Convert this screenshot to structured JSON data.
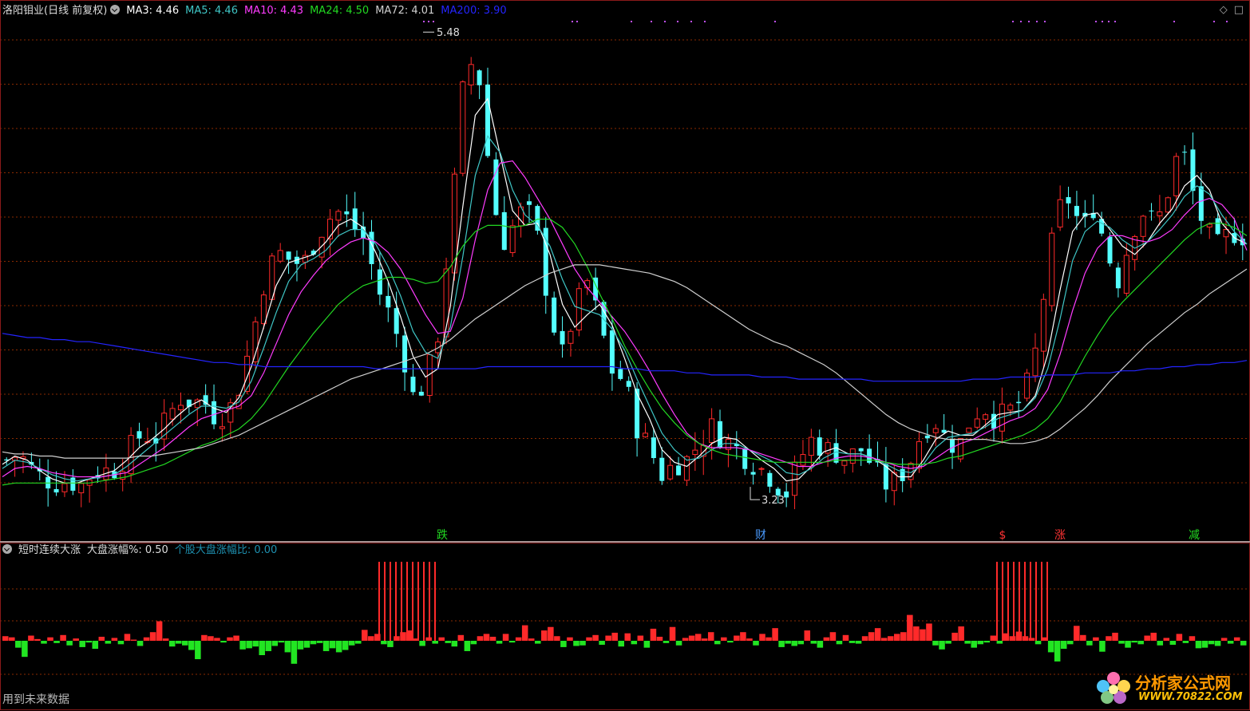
{
  "header": {
    "title": "洛阳钼业(日线 前复权)",
    "ma": [
      {
        "label": "MA3: 4.46",
        "color": "#ffffff"
      },
      {
        "label": "MA5: 4.46",
        "color": "#3fc6c6"
      },
      {
        "label": "MA10: 4.43",
        "color": "#ff3cff"
      },
      {
        "label": "MA24: 4.50",
        "color": "#22d822"
      },
      {
        "label": "MA72: 4.01",
        "color": "#d0d0d0"
      },
      {
        "label": "MA200: 3.90",
        "color": "#2424ff"
      }
    ]
  },
  "sub_header": {
    "name": "短时连续大涨",
    "index_change": "大盘涨幅%: 0.50",
    "ratio": "个股大盘涨幅比: 0.00",
    "ratio_color": "#1e90b0"
  },
  "footer_note": "用到未来数据",
  "watermark": {
    "text": "分析家公式网",
    "url": "WWW.70822.COM"
  },
  "corner_icons": [
    "diamond-icon",
    "square-icon"
  ],
  "colors": {
    "up": "#ff2a2a",
    "down": "#54ffff",
    "grid": "#8a2a00"
  },
  "chart_data": [
    {
      "type": "candlestick",
      "ylim": [
        3.1,
        5.55
      ],
      "annotations": [
        {
          "label": "5.48",
          "price": 5.48,
          "kind": "high"
        },
        {
          "label": "3.23",
          "price": 3.23,
          "kind": "low"
        }
      ],
      "event_markers": [
        {
          "label": "跌",
          "color": "#22d822"
        },
        {
          "label": "财",
          "color": "#4a9bff"
        },
        {
          "label": "$",
          "color": "#ff3333"
        },
        {
          "label": "涨",
          "color": "#ff3333"
        },
        {
          "label": "减",
          "color": "#22d822"
        }
      ],
      "close_path": [
        3.42,
        3.45,
        3.38,
        3.33,
        3.31,
        3.32,
        3.3,
        3.36,
        3.37,
        3.38,
        3.48,
        3.55,
        3.52,
        3.62,
        3.72,
        3.7,
        3.7,
        3.62,
        3.66,
        3.8,
        4.05,
        4.32,
        4.42,
        4.38,
        4.36,
        4.48,
        4.58,
        4.62,
        4.55,
        4.48,
        4.25,
        4.12,
        3.95,
        3.7,
        3.82,
        4.05,
        4.6,
        5.25,
        5.38,
        4.85,
        4.45,
        4.55,
        4.65,
        4.48,
        4.12,
        3.92,
        4.15,
        4.28,
        4.08,
        3.85,
        3.8,
        3.58,
        3.48,
        3.35,
        3.4,
        3.42,
        3.5,
        3.58,
        3.52,
        3.48,
        3.42,
        3.38,
        3.33,
        3.25,
        3.4,
        3.52,
        3.48,
        3.46,
        3.42,
        3.48,
        3.4,
        3.3,
        3.32,
        3.4,
        3.55,
        3.62,
        3.52,
        3.48,
        3.62,
        3.68,
        3.62,
        3.65,
        3.7,
        3.85,
        4.25,
        4.62,
        4.68,
        4.52,
        4.65,
        4.42,
        4.28,
        4.52,
        4.62,
        4.55,
        4.72,
        4.95,
        4.7,
        4.52,
        4.45,
        4.52,
        4.5
      ],
      "ma3": [
        3.4,
        3.44,
        3.42,
        3.37,
        3.33,
        3.31,
        3.31,
        3.33,
        3.35,
        3.37,
        3.42,
        3.48,
        3.52,
        3.57,
        3.63,
        3.68,
        3.71,
        3.67,
        3.65,
        3.72,
        3.87,
        4.06,
        4.26,
        4.37,
        4.39,
        4.41,
        4.47,
        4.55,
        4.58,
        4.54,
        4.42,
        4.28,
        4.11,
        3.92,
        3.82,
        3.86,
        4.16,
        4.64,
        5.08,
        5.16,
        4.89,
        4.62,
        4.55,
        4.56,
        4.41,
        4.17,
        4.06,
        4.12,
        4.17,
        4.07,
        3.91,
        3.74,
        3.62,
        3.47,
        3.41,
        3.39,
        3.44,
        3.5,
        3.53,
        3.52,
        3.47,
        3.42,
        3.38,
        3.32,
        3.33,
        3.39,
        3.46,
        3.48,
        3.45,
        3.45,
        3.43,
        3.39,
        3.34,
        3.34,
        3.42,
        3.52,
        3.56,
        3.54,
        3.54,
        3.59,
        3.64,
        3.65,
        3.66,
        3.73,
        3.93,
        4.24,
        4.52,
        4.6,
        4.61,
        4.53,
        4.45,
        4.41,
        4.47,
        4.56,
        4.63,
        4.74,
        4.79,
        4.72,
        4.56,
        4.49,
        4.46
      ],
      "ma5": [
        3.38,
        3.42,
        3.41,
        3.38,
        3.35,
        3.33,
        3.32,
        3.33,
        3.34,
        3.35,
        3.39,
        3.44,
        3.49,
        3.54,
        3.59,
        3.64,
        3.68,
        3.68,
        3.67,
        3.7,
        3.8,
        3.96,
        4.13,
        4.28,
        4.36,
        4.39,
        4.43,
        4.5,
        4.53,
        4.53,
        4.46,
        4.35,
        4.21,
        4.04,
        3.94,
        3.91,
        4.06,
        4.4,
        4.79,
        4.98,
        4.9,
        4.72,
        4.6,
        4.55,
        4.45,
        4.29,
        4.16,
        4.14,
        4.12,
        4.05,
        3.95,
        3.81,
        3.68,
        3.55,
        3.47,
        3.42,
        3.43,
        3.47,
        3.5,
        3.5,
        3.47,
        3.44,
        3.41,
        3.36,
        3.35,
        3.38,
        3.43,
        3.46,
        3.45,
        3.45,
        3.43,
        3.4,
        3.37,
        3.36,
        3.4,
        3.48,
        3.53,
        3.54,
        3.55,
        3.58,
        3.62,
        3.64,
        3.66,
        3.72,
        3.86,
        4.1,
        4.38,
        4.52,
        4.57,
        4.54,
        4.48,
        4.44,
        4.47,
        4.53,
        4.6,
        4.69,
        4.74,
        4.7,
        4.6,
        4.52,
        4.46
      ],
      "ma10": [
        3.34,
        3.38,
        3.39,
        3.38,
        3.36,
        3.35,
        3.34,
        3.34,
        3.34,
        3.35,
        3.36,
        3.4,
        3.44,
        3.48,
        3.53,
        3.58,
        3.62,
        3.64,
        3.66,
        3.68,
        3.73,
        3.84,
        3.98,
        4.12,
        4.23,
        4.31,
        4.38,
        4.43,
        4.47,
        4.49,
        4.47,
        4.42,
        4.34,
        4.23,
        4.12,
        4.03,
        4.04,
        4.2,
        4.48,
        4.72,
        4.85,
        4.86,
        4.78,
        4.68,
        4.58,
        4.46,
        4.34,
        4.25,
        4.18,
        4.11,
        4.04,
        3.95,
        3.85,
        3.74,
        3.64,
        3.55,
        3.5,
        3.48,
        3.48,
        3.48,
        3.47,
        3.45,
        3.43,
        3.41,
        3.39,
        3.39,
        3.41,
        3.43,
        3.44,
        3.44,
        3.43,
        3.41,
        3.39,
        3.38,
        3.39,
        3.43,
        3.47,
        3.5,
        3.52,
        3.55,
        3.58,
        3.61,
        3.63,
        3.67,
        3.76,
        3.93,
        4.14,
        4.32,
        4.44,
        4.5,
        4.5,
        4.48,
        4.47,
        4.49,
        4.53,
        4.6,
        4.66,
        4.68,
        4.65,
        4.58,
        4.43
      ],
      "ma24": [
        3.3,
        3.31,
        3.31,
        3.31,
        3.31,
        3.31,
        3.31,
        3.31,
        3.32,
        3.33,
        3.34,
        3.36,
        3.38,
        3.4,
        3.43,
        3.46,
        3.49,
        3.51,
        3.54,
        3.57,
        3.62,
        3.69,
        3.78,
        3.87,
        3.95,
        4.03,
        4.1,
        4.17,
        4.22,
        4.26,
        4.28,
        4.3,
        4.3,
        4.29,
        4.27,
        4.28,
        4.35,
        4.45,
        4.52,
        4.55,
        4.55,
        4.54,
        4.55,
        4.58,
        4.58,
        4.54,
        4.46,
        4.35,
        4.22,
        4.1,
        3.97,
        3.86,
        3.76,
        3.67,
        3.6,
        3.54,
        3.5,
        3.47,
        3.45,
        3.44,
        3.43,
        3.42,
        3.41,
        3.41,
        3.41,
        3.41,
        3.41,
        3.42,
        3.42,
        3.42,
        3.42,
        3.41,
        3.4,
        3.4,
        3.4,
        3.41,
        3.43,
        3.44,
        3.46,
        3.48,
        3.5,
        3.52,
        3.54,
        3.57,
        3.62,
        3.7,
        3.81,
        3.92,
        4.02,
        4.11,
        4.18,
        4.24,
        4.3,
        4.36,
        4.42,
        4.48,
        4.53,
        4.56,
        4.56,
        4.54,
        4.5
      ],
      "ma72": [
        3.46,
        3.45,
        3.45,
        3.44,
        3.44,
        3.43,
        3.43,
        3.43,
        3.43,
        3.43,
        3.43,
        3.44,
        3.44,
        3.45,
        3.46,
        3.47,
        3.48,
        3.5,
        3.52,
        3.54,
        3.57,
        3.6,
        3.63,
        3.66,
        3.69,
        3.72,
        3.75,
        3.78,
        3.81,
        3.83,
        3.85,
        3.87,
        3.89,
        3.91,
        3.93,
        3.96,
        4.0,
        4.05,
        4.1,
        4.14,
        4.18,
        4.22,
        4.26,
        4.29,
        4.32,
        4.34,
        4.36,
        4.36,
        4.36,
        4.35,
        4.34,
        4.33,
        4.32,
        4.3,
        4.28,
        4.25,
        4.21,
        4.17,
        4.13,
        4.09,
        4.05,
        4.02,
        3.99,
        3.97,
        3.94,
        3.91,
        3.88,
        3.84,
        3.79,
        3.74,
        3.69,
        3.64,
        3.6,
        3.57,
        3.55,
        3.53,
        3.52,
        3.52,
        3.52,
        3.52,
        3.51,
        3.5,
        3.5,
        3.51,
        3.53,
        3.57,
        3.62,
        3.67,
        3.73,
        3.8,
        3.86,
        3.92,
        3.98,
        4.03,
        4.08,
        4.13,
        4.17,
        4.22,
        4.26,
        4.3,
        4.34
      ],
      "ma200": [
        4.03,
        4.02,
        4.01,
        4.01,
        4.0,
        4.0,
        3.99,
        3.99,
        3.98,
        3.97,
        3.96,
        3.95,
        3.94,
        3.93,
        3.92,
        3.91,
        3.9,
        3.89,
        3.89,
        3.88,
        3.88,
        3.87,
        3.87,
        3.87,
        3.87,
        3.87,
        3.87,
        3.87,
        3.87,
        3.87,
        3.86,
        3.86,
        3.86,
        3.86,
        3.86,
        3.86,
        3.86,
        3.86,
        3.86,
        3.87,
        3.87,
        3.87,
        3.87,
        3.87,
        3.87,
        3.87,
        3.87,
        3.87,
        3.87,
        3.87,
        3.86,
        3.86,
        3.85,
        3.85,
        3.85,
        3.84,
        3.84,
        3.83,
        3.83,
        3.83,
        3.83,
        3.82,
        3.82,
        3.82,
        3.81,
        3.81,
        3.81,
        3.81,
        3.81,
        3.81,
        3.8,
        3.8,
        3.8,
        3.8,
        3.8,
        3.8,
        3.8,
        3.8,
        3.81,
        3.81,
        3.81,
        3.82,
        3.82,
        3.82,
        3.83,
        3.83,
        3.83,
        3.84,
        3.84,
        3.84,
        3.85,
        3.85,
        3.86,
        3.86,
        3.87,
        3.87,
        3.88,
        3.88,
        3.89,
        3.89,
        3.9
      ]
    },
    {
      "type": "bar",
      "baseline": 0,
      "spike_groups": [
        {
          "label": "group-1",
          "count": 11
        },
        {
          "label": "group-2",
          "count": 10
        }
      ],
      "values": [
        0.8,
        0.6,
        -1.2,
        -2.8,
        0.9,
        0.3,
        -0.5,
        0.6,
        -0.4,
        1.0,
        -0.8,
        0.4,
        -1.1,
        -0.3,
        -1.4,
        0.7,
        -0.5,
        0.5,
        -0.6,
        1.2,
        0.2,
        -0.9,
        0.6,
        1.5,
        3.4,
        0.4,
        -1.0,
        -0.5,
        -0.8,
        -1.6,
        -3.2,
        1.0,
        0.8,
        0.5,
        -0.3,
        0.6,
        0.9,
        -1.5,
        -1.3,
        -1.0,
        -2.5,
        -1.8,
        -0.9,
        -0.3,
        -2.0,
        -4.0,
        -1.5,
        -1.2,
        -0.6,
        -0.4,
        -1.8,
        -1.3,
        -2.0,
        -1.6,
        -0.8,
        -0.5,
        1.9,
        0.8,
        1.2,
        -0.6,
        -1.1,
        0.8,
        1.5,
        1.8,
        0.4,
        -0.9,
        0.6,
        -0.5,
        0.6,
        -0.4,
        -1.0,
        1.0,
        -1.8,
        -0.6,
        0.8,
        1.2,
        0.7,
        -0.5,
        1.2,
        -0.3,
        0.6,
        2.7,
        0.4,
        -0.5,
        1.8,
        2.4,
        0.8,
        -1.1,
        0.6,
        -0.9,
        -0.8,
        0.6,
        1.0,
        -0.7,
        0.9,
        1.4,
        -1.0,
        1.3,
        -0.6,
        0.9,
        -1.2,
        2.1,
        0.7,
        -0.4,
        2.4,
        -0.8,
        0.5,
        0.9,
        1.2,
        0.4,
        1.5,
        -0.6,
        0.6,
        -0.3,
        0.9,
        1.5,
        0.4,
        -0.8,
        1.2,
        0.6,
        2.2,
        -1.1,
        -0.5,
        -0.9,
        -0.6,
        1.8,
        -0.5,
        -1.2,
        0.6,
        1.5,
        -0.6,
        1.0,
        -0.4,
        -0.5,
        0.8,
        1.5,
        2.2,
        0.5,
        0.8,
        1.2,
        1.5,
        4.5,
        2.5,
        2.0,
        3.0,
        -0.8,
        -1.5,
        -0.5,
        1.4,
        2.5,
        -0.5,
        -1.2,
        -0.6,
        -0.3,
        0.9,
        -0.5,
        1.3,
        0.8,
        1.6,
        0.8,
        0.5,
        -0.6,
        0.6,
        -2.0,
        -3.6,
        -1.4,
        -0.6,
        2.6,
        1.0,
        -0.8,
        0.6,
        -1.9,
        0.8,
        1.4,
        -0.5,
        -1.2,
        -0.3,
        -0.6,
        0.9,
        1.4,
        -0.8,
        0.5,
        -0.7,
        1.2,
        -0.4,
        0.8,
        -1.3,
        -1.2,
        -0.6,
        -0.9,
        0.5,
        -0.5,
        0.6,
        -0.8
      ]
    }
  ]
}
